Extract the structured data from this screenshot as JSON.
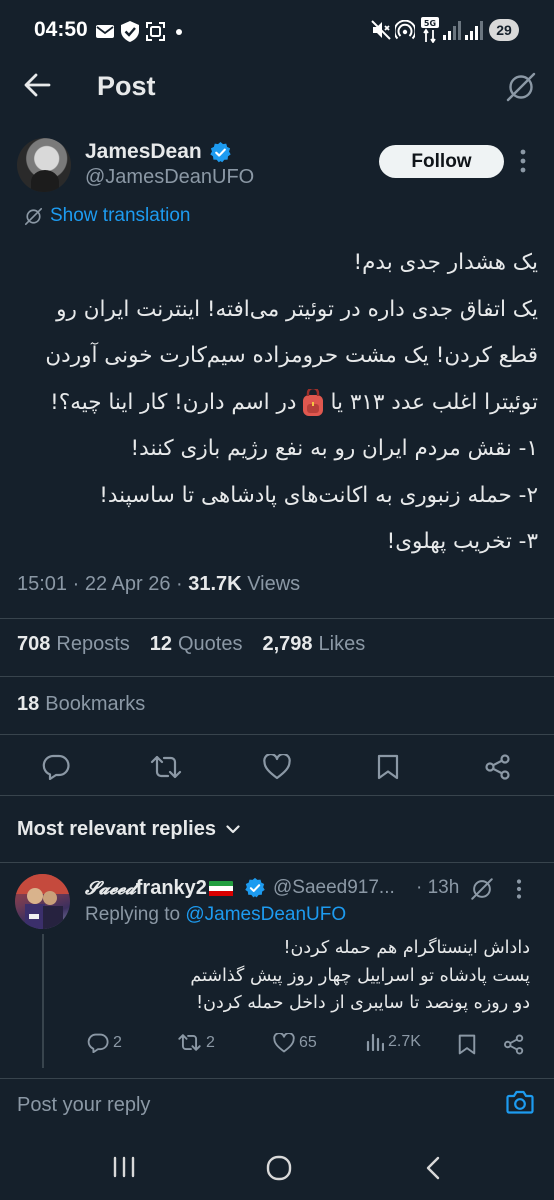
{
  "status_bar": {
    "time": "04:50",
    "battery": "29",
    "network": "5G"
  },
  "header": {
    "title": "Post"
  },
  "tweet": {
    "author_name": "JamesDean",
    "author_handle": "@JamesDeanUFO",
    "follow_label": "Follow",
    "show_translation": "Show translation",
    "lines": [
      "یک هشدار جدی بدم!",
      "یک اتفاق جدی داره در توئیتر می‌افته! اینترنت ایران رو",
      "قطع کردن! یک مشت حرومزاده سیم‌کارت خونی آوردن",
      "توئیترا اغلب عدد ۳۱۳ یا",
      "در اسم دارن! کار اینا چیه؟!",
      "۱- نقش مردم ایران رو به نفع رژیم بازی کنند!",
      "۲- حمله زنبوری به اکانت‌های پادشاهی تا ساسپند!",
      "۳- تخریب پهلوی!"
    ],
    "time": "15:01",
    "date": "22 Apr 26",
    "views_count": "31.7K",
    "views_label": "Views",
    "reposts_count": "708",
    "reposts_label": "Reposts",
    "quotes_count": "12",
    "quotes_label": "Quotes",
    "likes_count": "2,798",
    "likes_label": "Likes",
    "bookmarks_count": "18",
    "bookmarks_label": "Bookmarks"
  },
  "replies": {
    "sort_label": "Most relevant replies",
    "items": [
      {
        "name_stylized": "𝓢𝓪𝓮𝓮𝓭",
        "name": "franky2",
        "handle": "@Saeed917...",
        "time": "· 13h",
        "replying_prefix": "Replying to",
        "replying_handle": "@JamesDeanUFO",
        "lines": [
          "داداش اینستاگرام هم حمله کردن!",
          "پست پادشاه تو اسراییل چهار روز پیش گذاشتم",
          "دو روزه پونصد تا سایبری از داخل حمله کردن!"
        ],
        "reply_count": "2",
        "repost_count": "2",
        "like_count": "65",
        "view_count": "2.7K"
      }
    ]
  },
  "composer": {
    "placeholder": "Post your reply"
  },
  "colors": {
    "background": "#15202b",
    "accent": "#1d9bf0",
    "muted": "#8b98a5",
    "text": "#e7e9ea",
    "divider": "#38444d"
  }
}
